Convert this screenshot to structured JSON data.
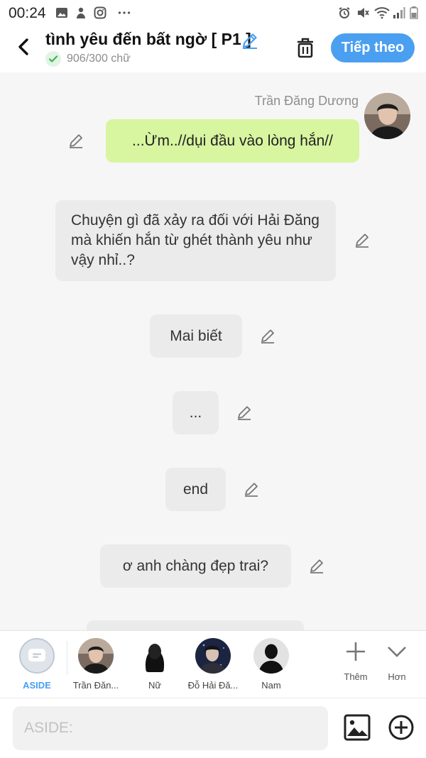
{
  "status_bar": {
    "time": "00:24",
    "icons": [
      "gallery-icon",
      "person-icon",
      "instagram-icon",
      "more-icon",
      "alarm-icon",
      "mute-icon",
      "wifi-icon",
      "signal-icon",
      "battery-icon"
    ]
  },
  "header": {
    "title": "tình yêu đến bất ngờ [ P1 ]",
    "word_count": "906/300 chữ",
    "next_label": "Tiếp theo",
    "accent": "#4a9ff0"
  },
  "chat": {
    "speaker_name": "Trần Đăng Dương",
    "messages": [
      {
        "text": "...Ừm..//dụi đầu vào lòng hắn//",
        "side": "me"
      },
      {
        "text": "Chuyện gì đã xảy ra đối với Hải Đăng mà khiến hắn từ ghét thành yêu như vậy nhỉ..?",
        "side": "aside"
      },
      {
        "text": "Mai biết",
        "side": "aside"
      },
      {
        "text": "...",
        "side": "aside"
      },
      {
        "text": "end",
        "side": "aside"
      },
      {
        "text": "ơ anh chàng đẹp trai?",
        "side": "aside"
      }
    ],
    "bubble_colors": {
      "me": "#d8f5a0",
      "aside": "#ebebeb"
    }
  },
  "characters": [
    {
      "label": "ASIDE",
      "active": true
    },
    {
      "label": "Trần Đăn..."
    },
    {
      "label": "Nữ"
    },
    {
      "label": "Đỗ Hải Đă..."
    },
    {
      "label": "Nam"
    }
  ],
  "tools": {
    "add_label": "Thêm",
    "more_label": "Hơn"
  },
  "input": {
    "placeholder": "ASIDE:"
  }
}
